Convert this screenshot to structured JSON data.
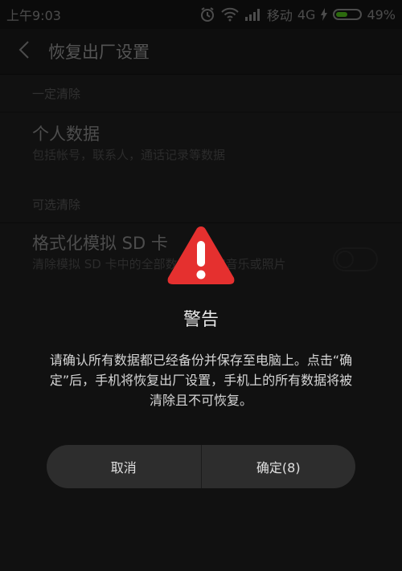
{
  "status_bar": {
    "time": "上午9:03",
    "carrier": "移动",
    "network": "4G",
    "battery": "49%",
    "battery_level": 0.49,
    "icons": [
      "alarm-clock-icon",
      "wifi-icon",
      "signal-icon",
      "charging-bolt-icon",
      "battery-icon"
    ]
  },
  "header": {
    "back_icon": "chevron-left-icon",
    "title": "恢复出厂设置"
  },
  "sections": [
    {
      "header": "一定清除",
      "item": {
        "title": "个人数据",
        "description": "包括帐号，联系人，通话记录等数据"
      }
    },
    {
      "header": "可选清除",
      "item": {
        "title": "格式化模拟 SD 卡",
        "description": "清除模拟 SD 卡中的全部数据，例如音乐或照片",
        "toggle_on": false
      }
    }
  ],
  "dialog": {
    "icon": "warning-icon",
    "title": "警告",
    "message": "请确认所有数据都已经备份并保存至电脑上。点击“确定”后，手机将恢复出厂设置，手机上的所有数据将被清除且不可恢复。",
    "cancel_label": "取消",
    "confirm_label": "确定(8)"
  },
  "colors": {
    "accent_warning": "#e5302f",
    "battery_green": "#51c21a",
    "background": "#1f1f1f"
  }
}
